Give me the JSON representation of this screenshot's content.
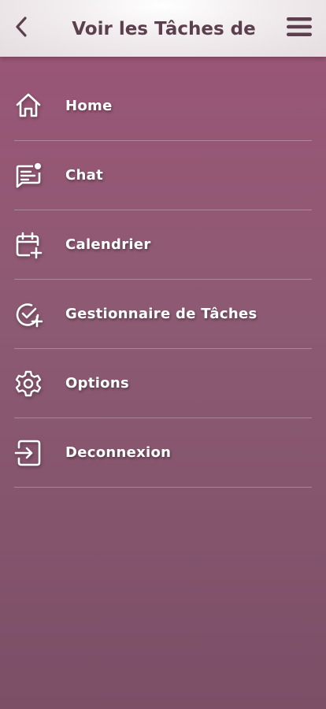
{
  "header": {
    "title": "Voir les Tâches de",
    "back_icon": "chevron-left-icon",
    "menu_icon": "hamburger-menu-icon"
  },
  "menu": {
    "items": [
      {
        "label": "Home",
        "icon": "home-icon"
      },
      {
        "label": "Chat",
        "icon": "chat-icon"
      },
      {
        "label": "Calendrier",
        "icon": "calendar-add-icon"
      },
      {
        "label": "Gestionnaire de Tâches",
        "icon": "task-check-icon"
      },
      {
        "label": "Options",
        "icon": "gear-icon"
      },
      {
        "label": "Deconnexion",
        "icon": "logout-icon"
      }
    ]
  },
  "colors": {
    "background_top": "#9c5577",
    "background_bottom": "#7c4f67",
    "header_bg": "#f1ecee",
    "header_text": "#5b3f4c",
    "menu_text": "#ffffff"
  }
}
